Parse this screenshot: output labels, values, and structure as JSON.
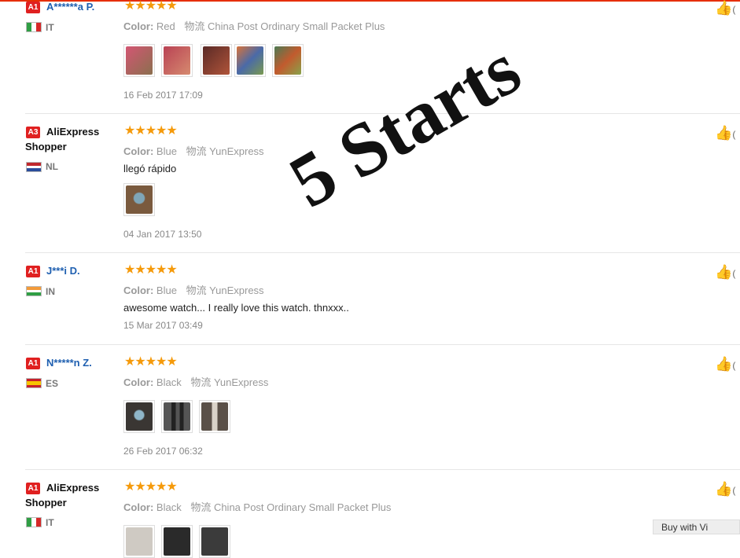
{
  "reviews": [
    {
      "level": "A1",
      "user": "A******a P.",
      "country": "IT",
      "stars": "★★★★★",
      "color_label": "Color:",
      "color_value": "Red",
      "shipping": "物流 China Post Ordinary Small Packet Plus",
      "text": "",
      "date": "16 Feb 2017 17:09",
      "thumb_colors": [
        "#c94b62",
        "#c44754",
        "#6b2d2a",
        "#c7652c",
        "#4b7a53"
      ]
    },
    {
      "level": "A3",
      "user": "AliExpress Shopper",
      "country": "NL",
      "stars": "★★★★★",
      "color_label": "Color:",
      "color_value": "Blue",
      "shipping": "物流 YunExpress",
      "text": "llegó rápido",
      "date": "04 Jan 2017 13:50",
      "thumb_colors": [
        "#7a5a3e"
      ]
    },
    {
      "level": "A1",
      "user": "J***i D.",
      "country": "IN",
      "stars": "★★★★★",
      "color_label": "Color:",
      "color_value": "Blue",
      "shipping": "物流 YunExpress",
      "text": "awesome watch... I really love this watch. thnxxx..",
      "date": "15 Mar 2017 03:49",
      "thumb_colors": []
    },
    {
      "level": "A1",
      "user": "N*****n Z.",
      "country": "ES",
      "stars": "★★★★★",
      "color_label": "Color:",
      "color_value": "Black",
      "shipping": "物流 YunExpress",
      "text": "",
      "date": "26 Feb 2017 06:32",
      "thumb_colors": [
        "#3a3633",
        "#2b2b2b",
        "#5a5048"
      ]
    },
    {
      "level": "A1",
      "user": "AliExpress Shopper",
      "country": "IT",
      "stars": "★★★★★",
      "color_label": "Color:",
      "color_value": "Black",
      "shipping": "物流 China Post Ordinary Small Packet Plus",
      "text": "",
      "date": "",
      "thumb_colors": [
        "#cfcac3",
        "#2a2a2a",
        "#3b3b3b"
      ]
    }
  ],
  "like_count": "(",
  "watermark": "5 Starts",
  "bottom_button": "Buy with Vi",
  "icons": {
    "thumbs_up": "thumbs-up-icon"
  },
  "colors": {
    "level_badge": "#e02020",
    "stars": "#f59a0b",
    "accent_line": "#e62e04",
    "masked_user": "#1e5fb0"
  }
}
